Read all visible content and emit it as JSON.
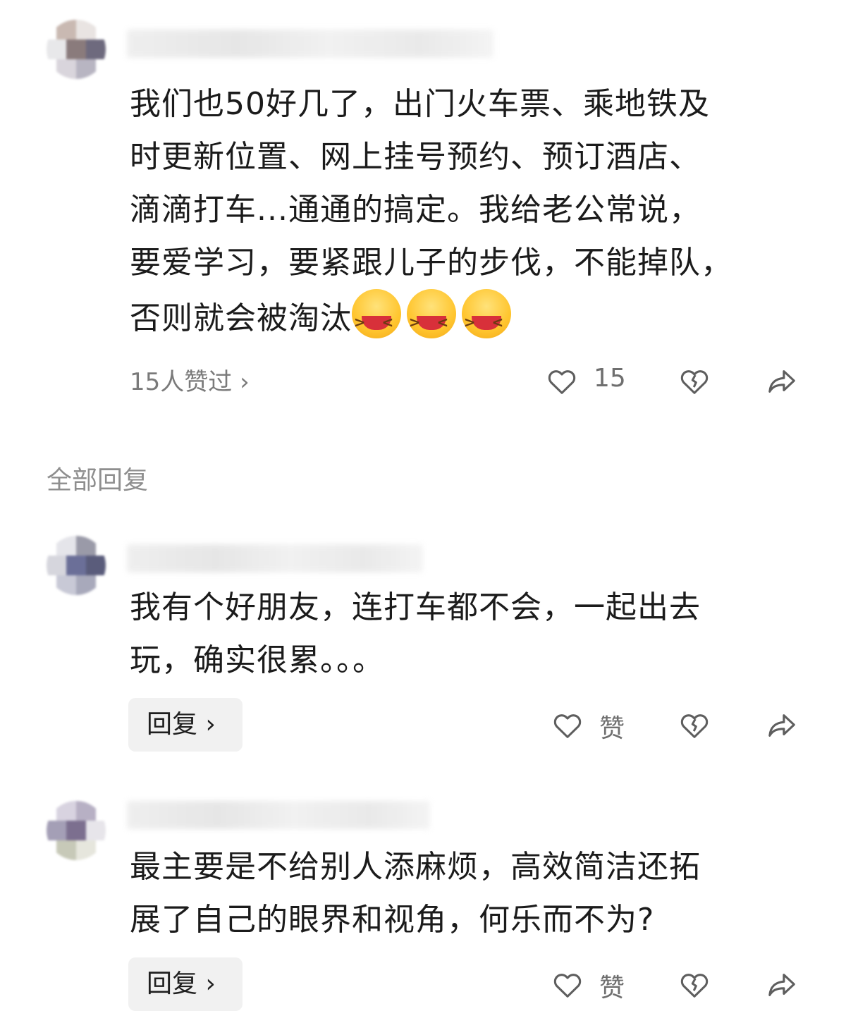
{
  "comments": [
    {
      "text_lines": [
        "我们也50好几了，出门火车票、乘地铁及",
        "时更新位置、网上挂号预约、预订酒店、",
        "滴滴打车...通通的搞定。我给老公常说，",
        "要爱学习，要紧跟儿子的步伐，不能掉队，",
        "否则就会被淘汰"
      ],
      "emoji_count": 3,
      "emoji_name": "laughing-emoji",
      "likes_link": "15人赞过 ›",
      "like_count": "15"
    },
    {
      "text_lines": [
        "我有个好朋友，连打车都不会，一起出去",
        "玩，确实很累。。。"
      ],
      "reply_label": "回复 ›",
      "like_label": "赞"
    },
    {
      "text_lines": [
        "最主要是不给别人添麻烦，高效简洁还拓",
        "展了自己的眼界和视角，何乐而不为?"
      ],
      "reply_label": "回复 ›",
      "like_label": "赞"
    }
  ],
  "section_label": "全部回复",
  "icons": {
    "like": "heart-outline-icon",
    "dislike": "broken-heart-icon",
    "share": "share-arrow-icon"
  }
}
